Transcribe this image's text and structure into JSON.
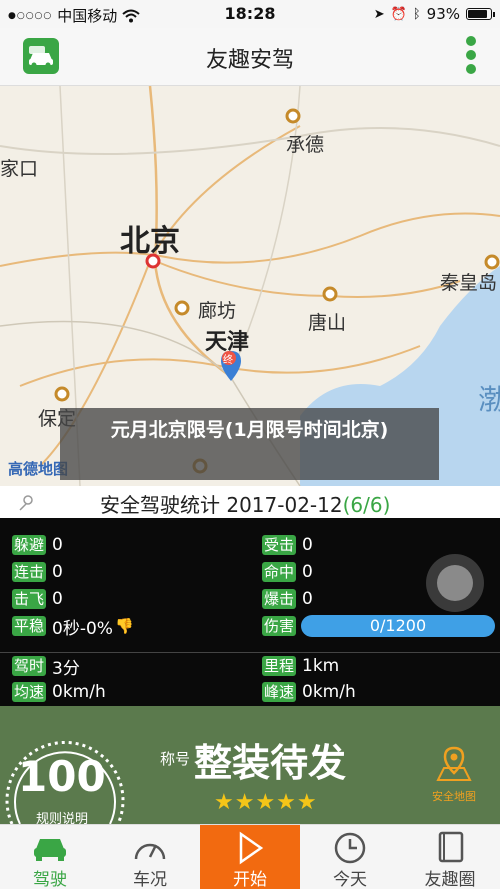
{
  "status_bar": {
    "carrier": "中国移动",
    "time": "18:28",
    "battery": "93%",
    "battery_fraction": 0.93
  },
  "header": {
    "title": "友趣安驾",
    "logo_icon": "car-app-icon",
    "menu_icon": "vertical-dots-icon"
  },
  "map": {
    "provider": "高德地图",
    "labels": {
      "beijing": "北京",
      "tianjin": "天津",
      "chengde": "承德",
      "zhangjiakou": "家口",
      "langfang": "廊坊",
      "tangshan": "唐山",
      "qinhuangdao": "秦皇岛",
      "baoding": "保定",
      "bohai": "渤",
      "end_marker": "终"
    },
    "overlay_text": "元月北京限号(1月限号时间北京)"
  },
  "stats": {
    "title": "安全驾驶统计 2017-02-12",
    "fraction": "(6/6)",
    "rows": {
      "dodge_label": "躲避",
      "dodge_value": "0",
      "hit_label": "受击",
      "hit_value": "0",
      "combo_label": "连击",
      "combo_value": "0",
      "hit_target_label": "命中",
      "hit_target_value": "0",
      "knock_label": "击飞",
      "knock_value": "0",
      "crit_label": "爆击",
      "crit_value": "0",
      "stable_label": "平稳",
      "stable_value": "0秒-0%",
      "damage_label": "伤害",
      "damage_value": "0/1200",
      "damage_fraction": 0.0,
      "drive_time_label": "驾时",
      "drive_time_value": "3分",
      "mileage_label": "里程",
      "mileage_value": "1km",
      "avg_speed_label": "均速",
      "avg_speed_value": "0km/h",
      "peak_speed_label": "峰速",
      "peak_speed_value": "0km/h"
    }
  },
  "score_panel": {
    "score": "100",
    "rules_link": "规则说明",
    "title_prefix": "称号",
    "title": "整装待发",
    "stars": "★★★★★",
    "star_count": 5,
    "safe_map_label": "安全地图"
  },
  "tabs": [
    {
      "label": "驾驶",
      "icon": "car-icon"
    },
    {
      "label": "车况",
      "icon": "speedometer-icon"
    },
    {
      "label": "开始",
      "icon": "play-icon"
    },
    {
      "label": "今天",
      "icon": "clock-icon"
    },
    {
      "label": "友趣圈",
      "icon": "book-icon"
    }
  ],
  "colors": {
    "accent_green": "#3aa645",
    "start_orange": "#f26a10",
    "progress_blue": "#3fa0e6",
    "panel_green": "#5b7a4d"
  }
}
